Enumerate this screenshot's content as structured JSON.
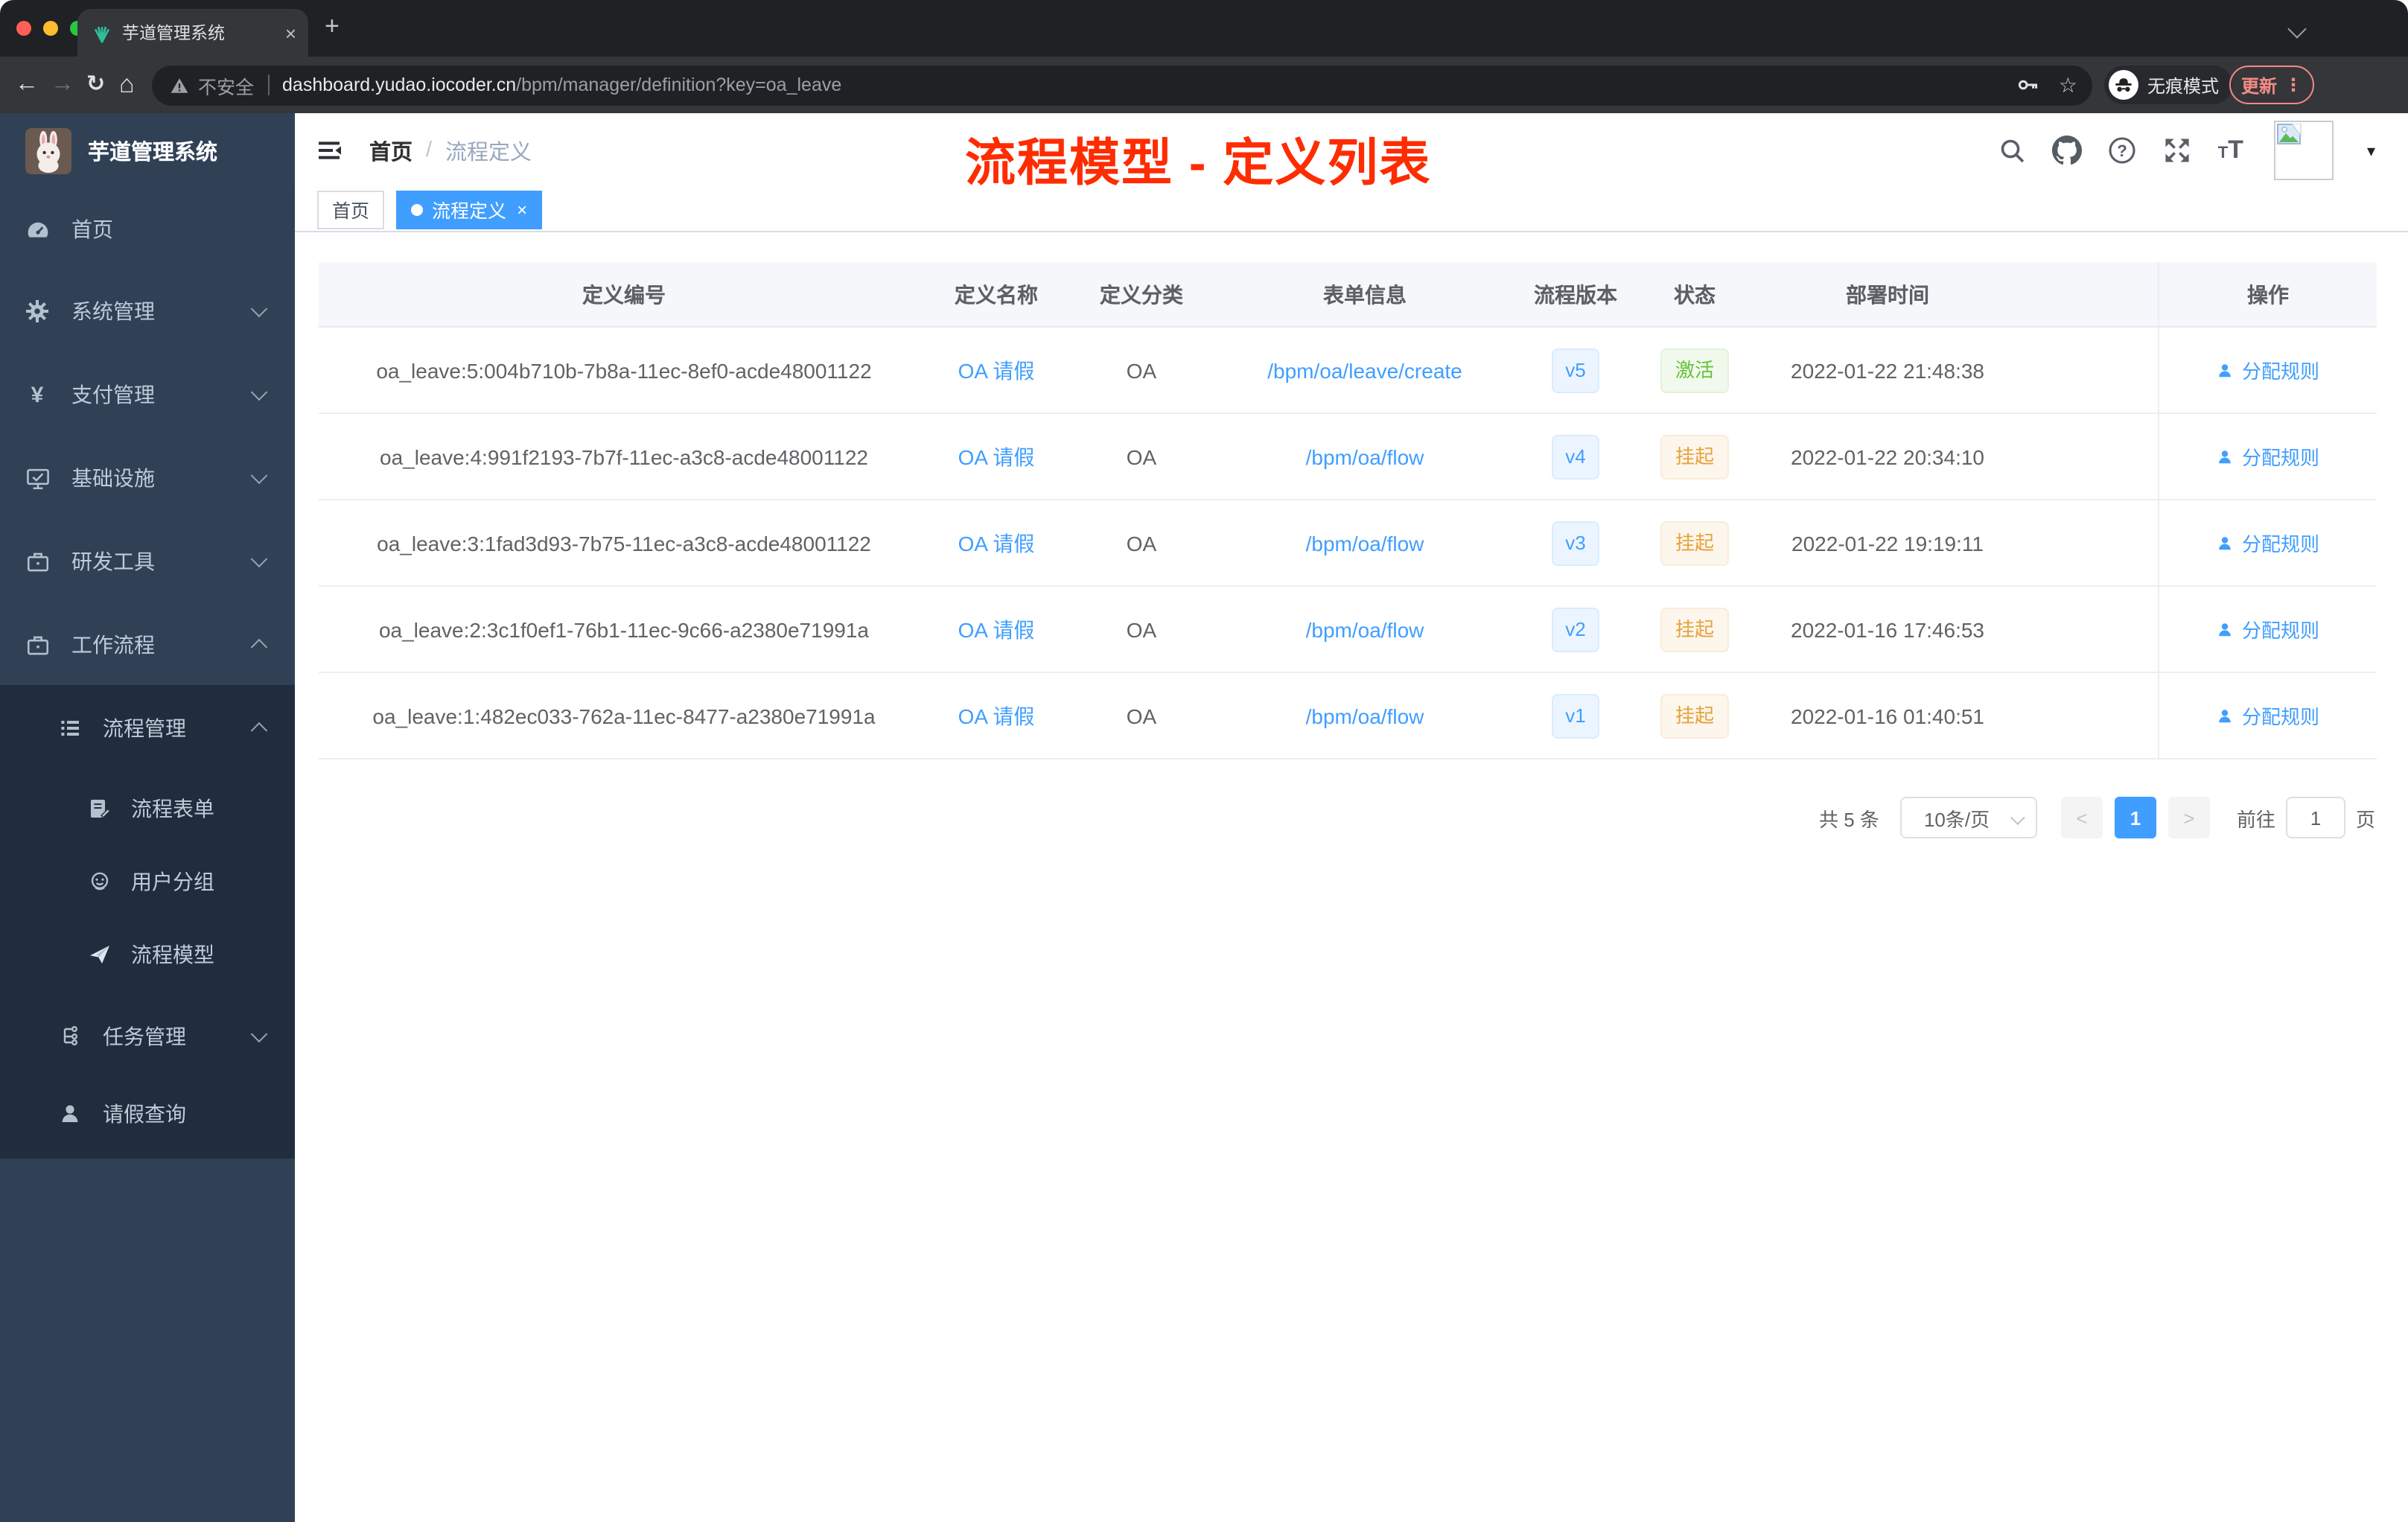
{
  "browser": {
    "tab_title": "芋道管理系统",
    "url": {
      "security": "不安全",
      "domain": "dashboard.yudao.iocoder.cn",
      "path": "/bpm/manager/definition?key=oa_leave"
    },
    "incognito_label": "无痕模式",
    "update_label": "更新"
  },
  "icons": {
    "close": "×",
    "new_tab": "+",
    "back": "←",
    "forward": "→",
    "reload": "↻",
    "home": "⌂",
    "star": "☆",
    "menu_dots": "⋮",
    "caret_down": "▾",
    "yen": "¥",
    "question": "?",
    "prev": "<",
    "next": ">",
    "font_small": "T",
    "font_large": "T"
  },
  "sidebar": {
    "app_title": "芋道管理系统",
    "items": [
      {
        "label": "首页"
      },
      {
        "label": "系统管理"
      },
      {
        "label": "支付管理"
      },
      {
        "label": "基础设施"
      },
      {
        "label": "研发工具"
      },
      {
        "label": "工作流程"
      },
      {
        "label": "流程管理"
      },
      {
        "label": "流程表单"
      },
      {
        "label": "用户分组"
      },
      {
        "label": "流程模型"
      },
      {
        "label": "任务管理"
      },
      {
        "label": "请假查询"
      }
    ]
  },
  "header": {
    "breadcrumb_home": "首页",
    "breadcrumb_sep": "/",
    "breadcrumb_current": "流程定义"
  },
  "tags": {
    "home": "首页",
    "active": "流程定义"
  },
  "annotation": {
    "title": "流程模型 - 定义列表"
  },
  "table": {
    "columns": {
      "id": "定义编号",
      "name": "定义名称",
      "category": "定义分类",
      "form": "表单信息",
      "version": "流程版本",
      "status": "状态",
      "deploy_time": "部署时间",
      "actions": "操作"
    },
    "action_label": "分配规则",
    "rows": [
      {
        "id": "oa_leave:5:004b710b-7b8a-11ec-8ef0-acde48001122",
        "name": "OA 请假",
        "category": "OA",
        "form": "/bpm/oa/leave/create",
        "version": "v5",
        "status": "激活",
        "deploy_time": "2022-01-22 21:48:38"
      },
      {
        "id": "oa_leave:4:991f2193-7b7f-11ec-a3c8-acde48001122",
        "name": "OA 请假",
        "category": "OA",
        "form": "/bpm/oa/flow",
        "version": "v4",
        "status": "挂起",
        "deploy_time": "2022-01-22 20:34:10"
      },
      {
        "id": "oa_leave:3:1fad3d93-7b75-11ec-a3c8-acde48001122",
        "name": "OA 请假",
        "category": "OA",
        "form": "/bpm/oa/flow",
        "version": "v3",
        "status": "挂起",
        "deploy_time": "2022-01-22 19:19:11"
      },
      {
        "id": "oa_leave:2:3c1f0ef1-76b1-11ec-9c66-a2380e71991a",
        "name": "OA 请假",
        "category": "OA",
        "form": "/bpm/oa/flow",
        "version": "v2",
        "status": "挂起",
        "deploy_time": "2022-01-16 17:46:53"
      },
      {
        "id": "oa_leave:1:482ec033-762a-11ec-8477-a2380e71991a",
        "name": "OA 请假",
        "category": "OA",
        "form": "/bpm/oa/flow",
        "version": "v1",
        "status": "挂起",
        "deploy_time": "2022-01-16 01:40:51"
      }
    ]
  },
  "pagination": {
    "total": "共 5 条",
    "page_size": "10条/页",
    "page": "1",
    "goto": "前往",
    "goto_value": "1",
    "unit": "页"
  },
  "colors": {
    "accent": "#409eff",
    "annotation_red": "#fe2c00",
    "sidebar_bg": "#304156",
    "submenu_bg": "#1f2d3d",
    "success": "#67c23a",
    "warning": "#e6a23c",
    "link": "#409eff"
  }
}
